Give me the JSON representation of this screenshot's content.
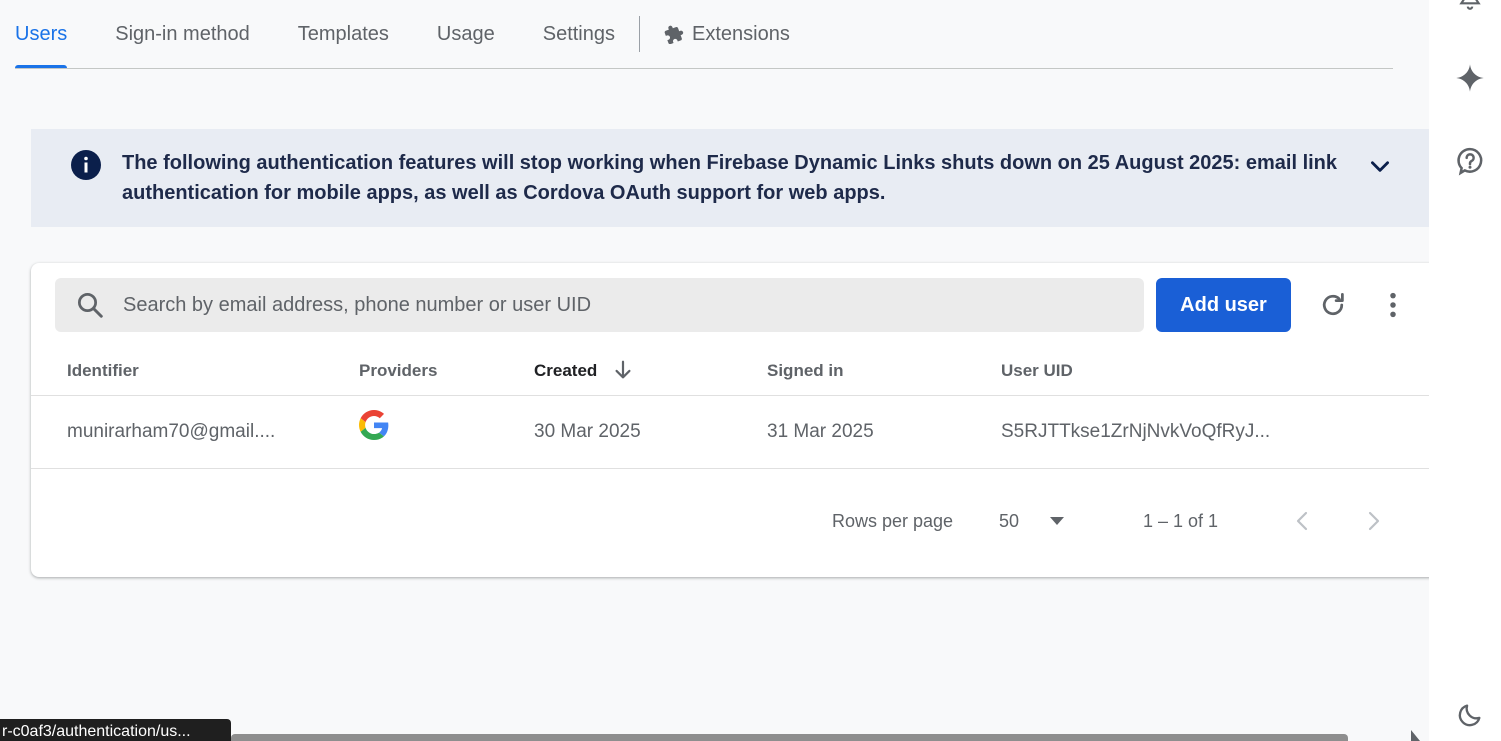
{
  "tabs": [
    {
      "label": "Users",
      "active": true
    },
    {
      "label": "Sign-in method",
      "active": false
    },
    {
      "label": "Templates",
      "active": false
    },
    {
      "label": "Usage",
      "active": false
    },
    {
      "label": "Settings",
      "active": false
    }
  ],
  "extensions_tab": {
    "label": "Extensions",
    "icon": "puzzle-icon"
  },
  "banner": {
    "icon": "info-icon",
    "text": "The following authentication features will stop working when Firebase Dynamic Links shuts down on 25 August 2025: email link authentication for mobile apps, as well as Cordova OAuth support for web apps.",
    "expand_icon": "chevron-down-icon"
  },
  "toolbar": {
    "search_placeholder": "Search by email address, phone number or user UID",
    "add_user_label": "Add user"
  },
  "table": {
    "columns": [
      "Identifier",
      "Providers",
      "Created",
      "Signed in",
      "User UID"
    ],
    "sorted_column": "Created",
    "rows": [
      {
        "identifier": "munirarham70@gmail....",
        "provider": "google-icon",
        "created": "30 Mar 2025",
        "signed_in": "31 Mar 2025",
        "uid": "S5RJTTkse1ZrNjNvkVoQfRyJ..."
      }
    ]
  },
  "pagination": {
    "rows_per_page_label": "Rows per page",
    "rows_per_page_value": "50",
    "range": "1 – 1 of 1"
  },
  "status_bar": {
    "url": "r-c0af3/authentication/us..."
  },
  "colors": {
    "accent": "#1a73e8",
    "button": "#1a5fd6",
    "banner_bg": "#e8ecf3",
    "banner_text": "#1e2a4a"
  }
}
